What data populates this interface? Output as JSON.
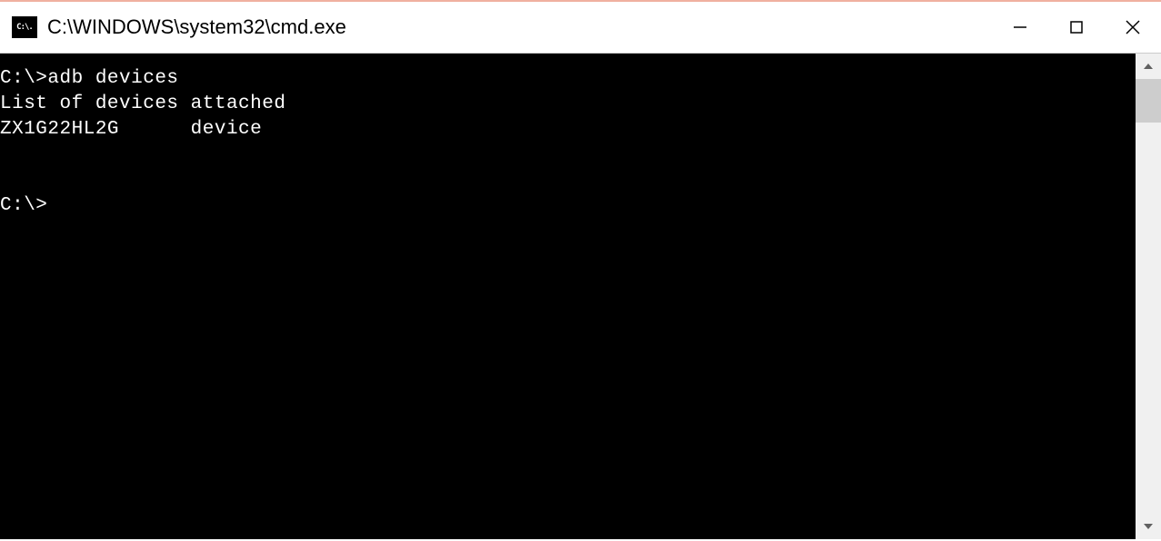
{
  "window": {
    "title": "C:\\WINDOWS\\system32\\cmd.exe",
    "icon_label": "C:\\."
  },
  "terminal": {
    "lines": [
      "C:\\>adb devices",
      "List of devices attached",
      "ZX1G22HL2G      device",
      "",
      "",
      "C:\\>"
    ]
  }
}
